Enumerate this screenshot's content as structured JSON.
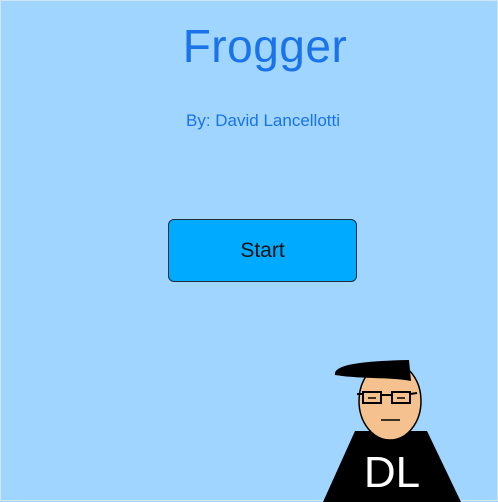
{
  "game": {
    "title": "Frogger",
    "byline": "By: David Lancellotti",
    "start_label": "Start",
    "avatar_initials": "DL"
  },
  "colors": {
    "background": "#9fd5fe",
    "title": "#1a73e8",
    "button": "#00aaff",
    "skin": "#f5c28f",
    "shirt": "#000000"
  }
}
